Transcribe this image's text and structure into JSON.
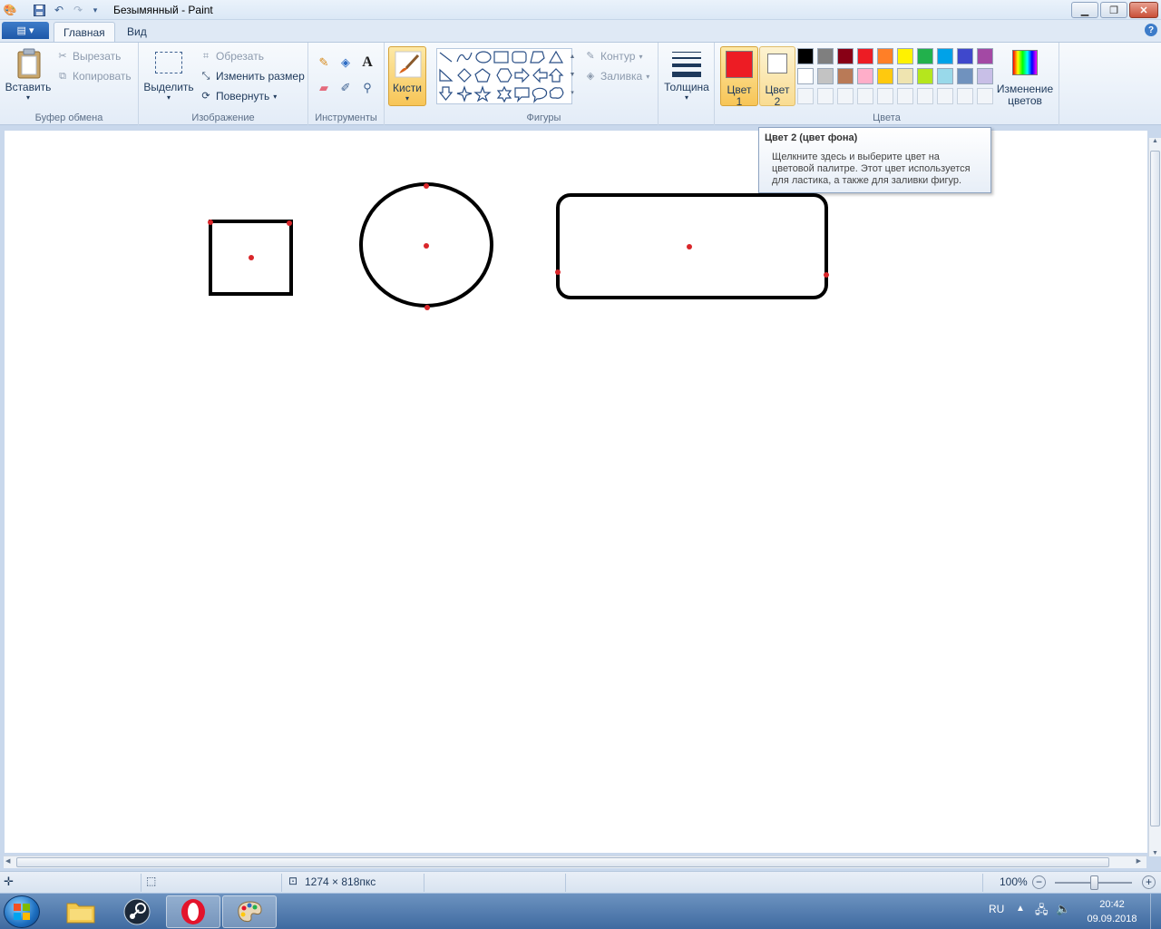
{
  "window": {
    "title": "Безымянный - Paint"
  },
  "tabs": [
    {
      "label": "Главная",
      "active": true
    },
    {
      "label": "Вид",
      "active": false
    }
  ],
  "ribbon": {
    "clipboard": {
      "paste_label": "Вставить",
      "cut_label": "Вырезать",
      "copy_label": "Копировать",
      "group_label": "Буфер обмена"
    },
    "image": {
      "select_label": "Выделить",
      "crop_label": "Обрезать",
      "resize_label": "Изменить размер",
      "rotate_label": "Повернуть",
      "group_label": "Изображение"
    },
    "tools": {
      "group_label": "Инструменты",
      "text_tool_glyph": "A"
    },
    "brushes": {
      "label": "Кисти"
    },
    "shapes": {
      "outline_label": "Контур",
      "fill_label": "Заливка",
      "group_label": "Фигуры"
    },
    "thickness": {
      "label": "Толщина"
    },
    "colors": {
      "color1_line1": "Цвет",
      "color1_line2": "1",
      "color2_line1": "Цвет",
      "color2_line2": "2",
      "edit_colors_line1": "Изменение",
      "edit_colors_line2": "цветов",
      "group_label": "Цвета",
      "color1_value": "#ed1c24",
      "color2_value": "#ffffff",
      "palette_row1": [
        "#000000",
        "#7f7f7f",
        "#880015",
        "#ed1c24",
        "#ff7f27",
        "#fff200",
        "#22b14c",
        "#00a2e8",
        "#3f48cc",
        "#a349a4"
      ],
      "palette_row2": [
        "#ffffff",
        "#c3c3c3",
        "#b97a57",
        "#ffaec9",
        "#ffc90e",
        "#efe4b0",
        "#b5e61d",
        "#99d9ea",
        "#7092be",
        "#c8bfe7"
      ]
    }
  },
  "tooltip": {
    "title": "Цвет 2 (цвет фона)",
    "line1": "Щелкните здесь и выберите цвет на",
    "line2": "цветовой палитре. Этот цвет используется",
    "line3": "для ластика, а также для заливки фигур."
  },
  "canvas": {
    "stroke_color": "#000000",
    "marker_color": "#d9262a"
  },
  "statusbar": {
    "image_size": "1274 × 818пкс",
    "zoom": "100%"
  },
  "taskbar": {
    "lang": "RU",
    "time": "20:42",
    "date": "09.09.2018"
  }
}
